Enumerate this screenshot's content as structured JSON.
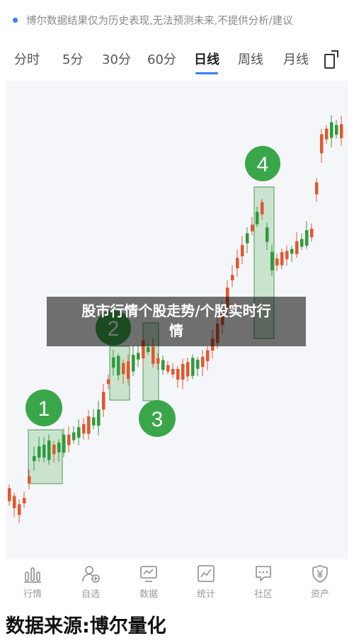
{
  "notice": {
    "text": "博尔数据结果仅为历史表现,无法预测未来,不提供分析/建议",
    "close_glyph": "×"
  },
  "tabs": [
    {
      "label": "分时",
      "active": false
    },
    {
      "label": "5分",
      "active": false
    },
    {
      "label": "30分",
      "active": false
    },
    {
      "label": "60分",
      "active": false
    },
    {
      "label": "日线",
      "active": true
    },
    {
      "label": "周线",
      "active": false
    },
    {
      "label": "月线",
      "active": false
    }
  ],
  "colors": {
    "accent": "#3b7cf6",
    "up": "#e2572e",
    "down": "#2e9b3c",
    "marker": "#3aa64a",
    "box_fill": "rgba(90,180,100,0.28)",
    "box_stroke": "#4a9b55"
  },
  "markers": [
    {
      "label": "1"
    },
    {
      "label": "2"
    },
    {
      "label": "3"
    },
    {
      "label": "4"
    }
  ],
  "overlay": {
    "line1": "股市行情个股走势/个股实时行",
    "line2": "情"
  },
  "nav": [
    {
      "label": "行情",
      "icon": "bar-chart-icon"
    },
    {
      "label": "自选",
      "icon": "user-add-icon"
    },
    {
      "label": "数据",
      "icon": "monitor-chart-icon"
    },
    {
      "label": "统计",
      "icon": "line-chart-icon"
    },
    {
      "label": "社区",
      "icon": "chat-icon"
    },
    {
      "label": "资产",
      "icon": "shield-yen-icon"
    }
  ],
  "source": "数据来源:博尔量化"
}
